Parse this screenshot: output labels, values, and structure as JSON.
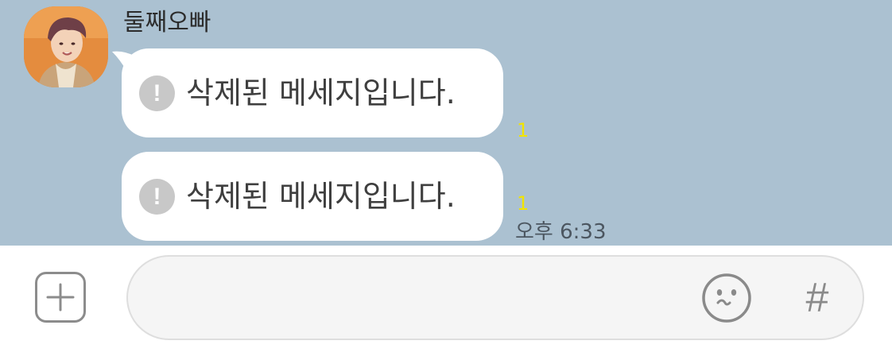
{
  "conversation": {
    "sender_name": "둘째오빠",
    "avatar_icon": "profile-photo-icon"
  },
  "messages": [
    {
      "icon": "exclamation-circle-icon",
      "icon_glyph": "!",
      "text": "삭제된 메세지입니다.",
      "unread_count": "1"
    },
    {
      "icon": "exclamation-circle-icon",
      "icon_glyph": "!",
      "text": "삭제된 메세지입니다.",
      "unread_count": "1"
    }
  ],
  "timestamp": "오후 6:33",
  "input_bar": {
    "plus_icon": "plus-square-icon",
    "message_value": "",
    "emoji_icon": "smiley-face-icon",
    "hash_label": "#"
  },
  "colors": {
    "chat_background": "#abc1d1",
    "bubble": "#ffffff",
    "unread": "#f2e400",
    "alert_icon": "#c8c8c8"
  }
}
